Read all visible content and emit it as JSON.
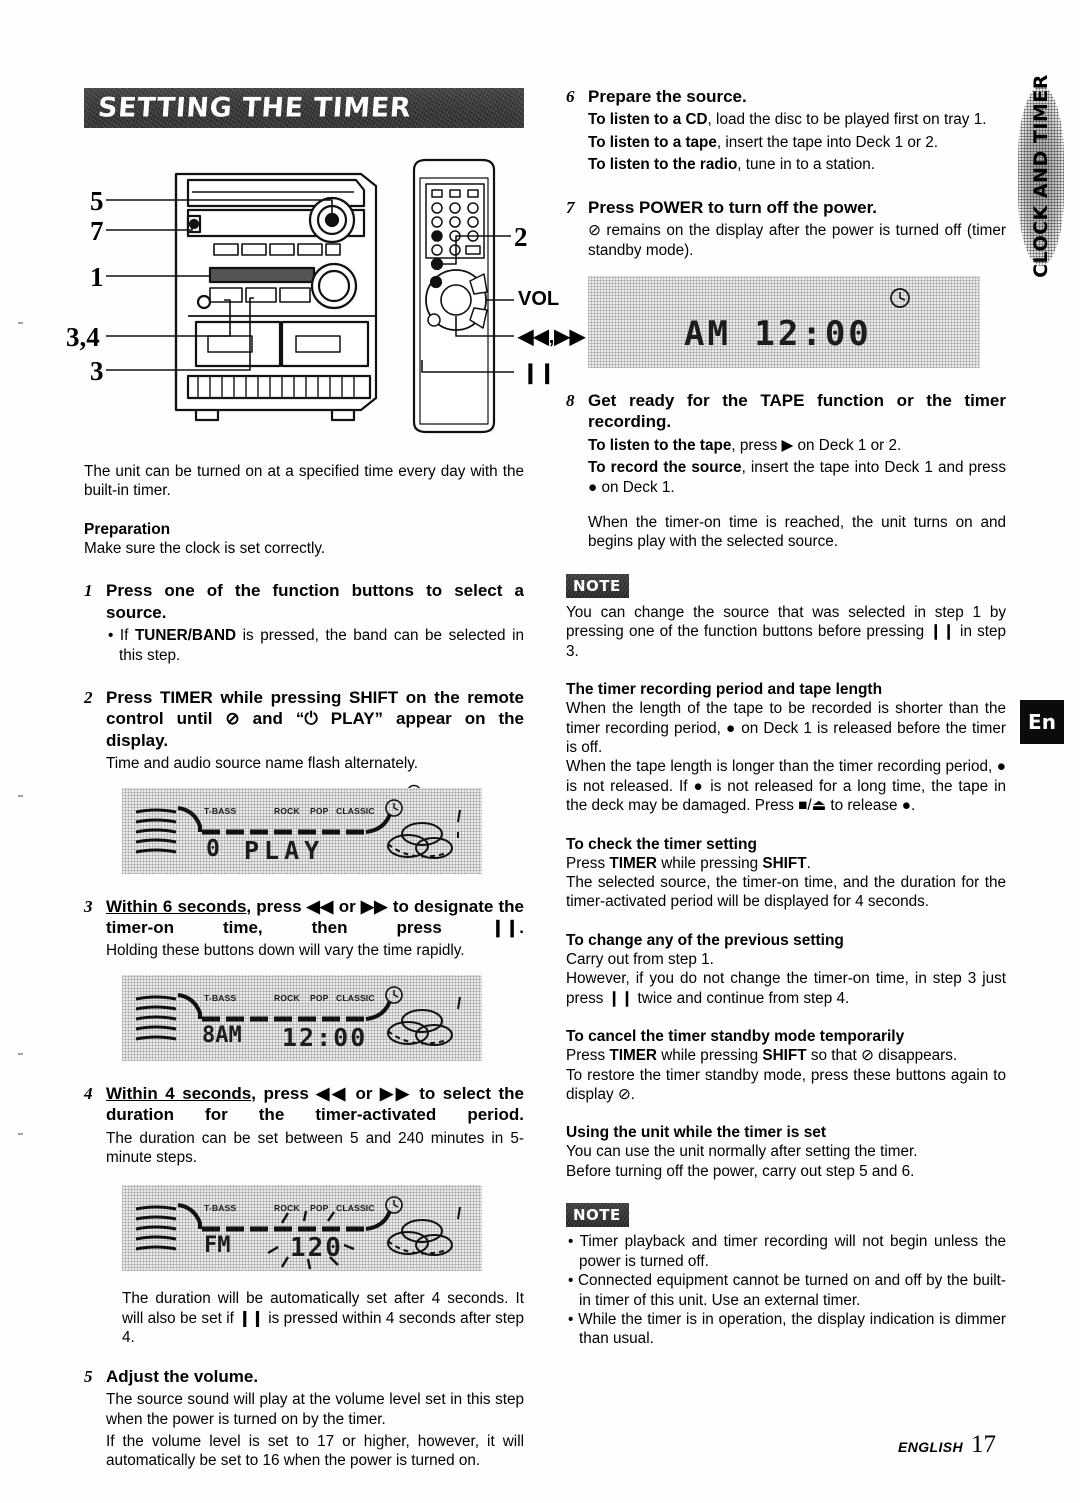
{
  "header": {
    "banner_title": "SETTING THE TIMER"
  },
  "side_tabs": {
    "section_tab": "CLOCK AND TIMER",
    "language_tab": "En"
  },
  "footer": {
    "label": "ENGLISH",
    "page_number": "17"
  },
  "diagram": {
    "callouts": {
      "c5": "5",
      "c7": "7",
      "c1": "1",
      "c34": "3,4",
      "c3": "3",
      "c2": "2",
      "vol": "VOL",
      "skip": "◀◀,▶▶",
      "pause": "❙❙"
    }
  },
  "left_column": {
    "intro": "The unit can be turned on at a specified time every day with the built-in timer.",
    "preparation_head": "Preparation",
    "preparation_text": "Make sure the clock is set correctly.",
    "steps": [
      {
        "num": "1",
        "title": "Press one of the function buttons to select a source.",
        "bullet": "• If TUNER/BAND is pressed, the band can be selected in this step.",
        "bullet_bold": "TUNER/BAND"
      },
      {
        "num": "2",
        "title": "Press TIMER while pressing SHIFT on the remote control until ⊘ and “⏻ PLAY” appear on the display.",
        "detail": "Time and audio source name flash alternately."
      },
      {
        "num": "3",
        "title": "Within 6 seconds, press ◀◀ or ▶▶ to designate the timer-on time, then press ❙❙.",
        "underline": "Within 6 seconds",
        "detail": "Holding these buttons down will vary the time rapidly."
      },
      {
        "num": "4",
        "title": "Within 4 seconds, press ◀◀ or ▶▶ to select the duration for the timer-activated period.",
        "underline": "Within 4 seconds",
        "detail": "The duration can be set between 5 and 240 minutes in 5-minute steps."
      },
      {
        "num": "5",
        "title": "Adjust the volume.",
        "detail": "The source sound will play at the volume level set in this step when the power is turned on by the timer.",
        "detail2": "If the volume level is set to 17 or higher, however, it will automatically be set to 16 when the power is turned on."
      }
    ],
    "after_step4_text": "The duration will be automatically set after 4 seconds. It will also be set if ❙❙ is pressed within 4 seconds after step 4.",
    "displays": [
      {
        "name": "display-play",
        "labels": [
          "T-BASS",
          "ROCK",
          "POP",
          "CLASSIC"
        ],
        "segment_text": "PLAY",
        "prefix_segment": "0",
        "clock_icon": "⊘"
      },
      {
        "name": "display-timer-on-time",
        "labels": [
          "T-BASS",
          "ROCK",
          "POP",
          "CLASSIC"
        ],
        "segment_text": "12:00",
        "prefix_segment": "8AM",
        "clock_icon": "⊘"
      },
      {
        "name": "display-duration",
        "labels": [
          "T-BASS",
          "ROCK",
          "POP",
          "CLASSIC"
        ],
        "segment_text": "120",
        "prefix_segment": "FM",
        "clock_icon": "⊘"
      }
    ]
  },
  "right_column": {
    "steps": [
      {
        "num": "6",
        "title": "Prepare the source.",
        "lines": [
          {
            "bold": "To listen to a CD",
            "rest": ", load the disc to be played first on tray 1."
          },
          {
            "bold": "To listen to a tape",
            "rest": ", insert the tape into Deck 1 or 2."
          },
          {
            "bold": "To listen to the radio",
            "rest": ", tune in to a station."
          }
        ]
      },
      {
        "num": "7",
        "title": "Press POWER to turn off the power.",
        "detail": "⊘ remains on the display after the power is turned off (timer standby mode)."
      },
      {
        "num": "8",
        "title": "Get ready for the TAPE function or the timer recording.",
        "lines": [
          {
            "bold": "To listen to the tape",
            "rest": ", press ▶ on Deck 1 or 2."
          },
          {
            "bold": "To record the source",
            "rest": ", insert the tape into Deck 1 and press ● on Deck 1."
          }
        ],
        "detail": "When the timer-on time is reached, the unit turns on and begins play with the selected source."
      }
    ],
    "display_standby": {
      "name": "display-standby",
      "segment_text": "AM  12:00",
      "clock_icon": "⊘"
    },
    "note1": {
      "badge": "NOTE",
      "text": "You can change the source that was selected in step 1 by pressing one of the function buttons before pressing ❙❙ in step 3."
    },
    "sections": [
      {
        "head": "The timer recording period and tape length",
        "paragraphs": [
          "When the length of the tape to be recorded is shorter than the timer recording period, ● on Deck 1 is released before the timer is off.",
          "When the tape length is longer than the timer recording period, ● is not released. If ● is not released for a long time, the tape in the deck may be damaged. Press ■/⏏ to release ●."
        ]
      },
      {
        "head": "To check the timer setting",
        "paragraphs": [
          "Press TIMER while pressing SHIFT.",
          "The selected source, the timer-on time, and the duration for the timer-activated period will be displayed for 4 seconds."
        ]
      },
      {
        "head": "To change any of the previous setting",
        "paragraphs": [
          "Carry out from step 1.",
          "However, if you do not change the timer-on time, in step 3 just press ❙❙ twice and continue from step 4."
        ]
      },
      {
        "head": "To cancel the timer standby mode temporarily",
        "paragraphs": [
          "Press TIMER while pressing SHIFT so that ⊘ disappears.",
          "To restore the timer standby mode, press these buttons again to display ⊘."
        ]
      },
      {
        "head": "Using the unit while the timer is set",
        "paragraphs": [
          "You can use the unit normally after setting the timer.",
          "Before turning off the power, carry out step 5 and 6."
        ]
      }
    ],
    "note2": {
      "badge": "NOTE",
      "bullets": [
        "• Timer playback and timer recording will not begin unless the power is turned off.",
        "• Connected equipment cannot be turned on and off by the built-in timer of this unit.  Use an external timer.",
        "• While the timer is in operation, the display indication is dimmer than usual."
      ]
    }
  }
}
